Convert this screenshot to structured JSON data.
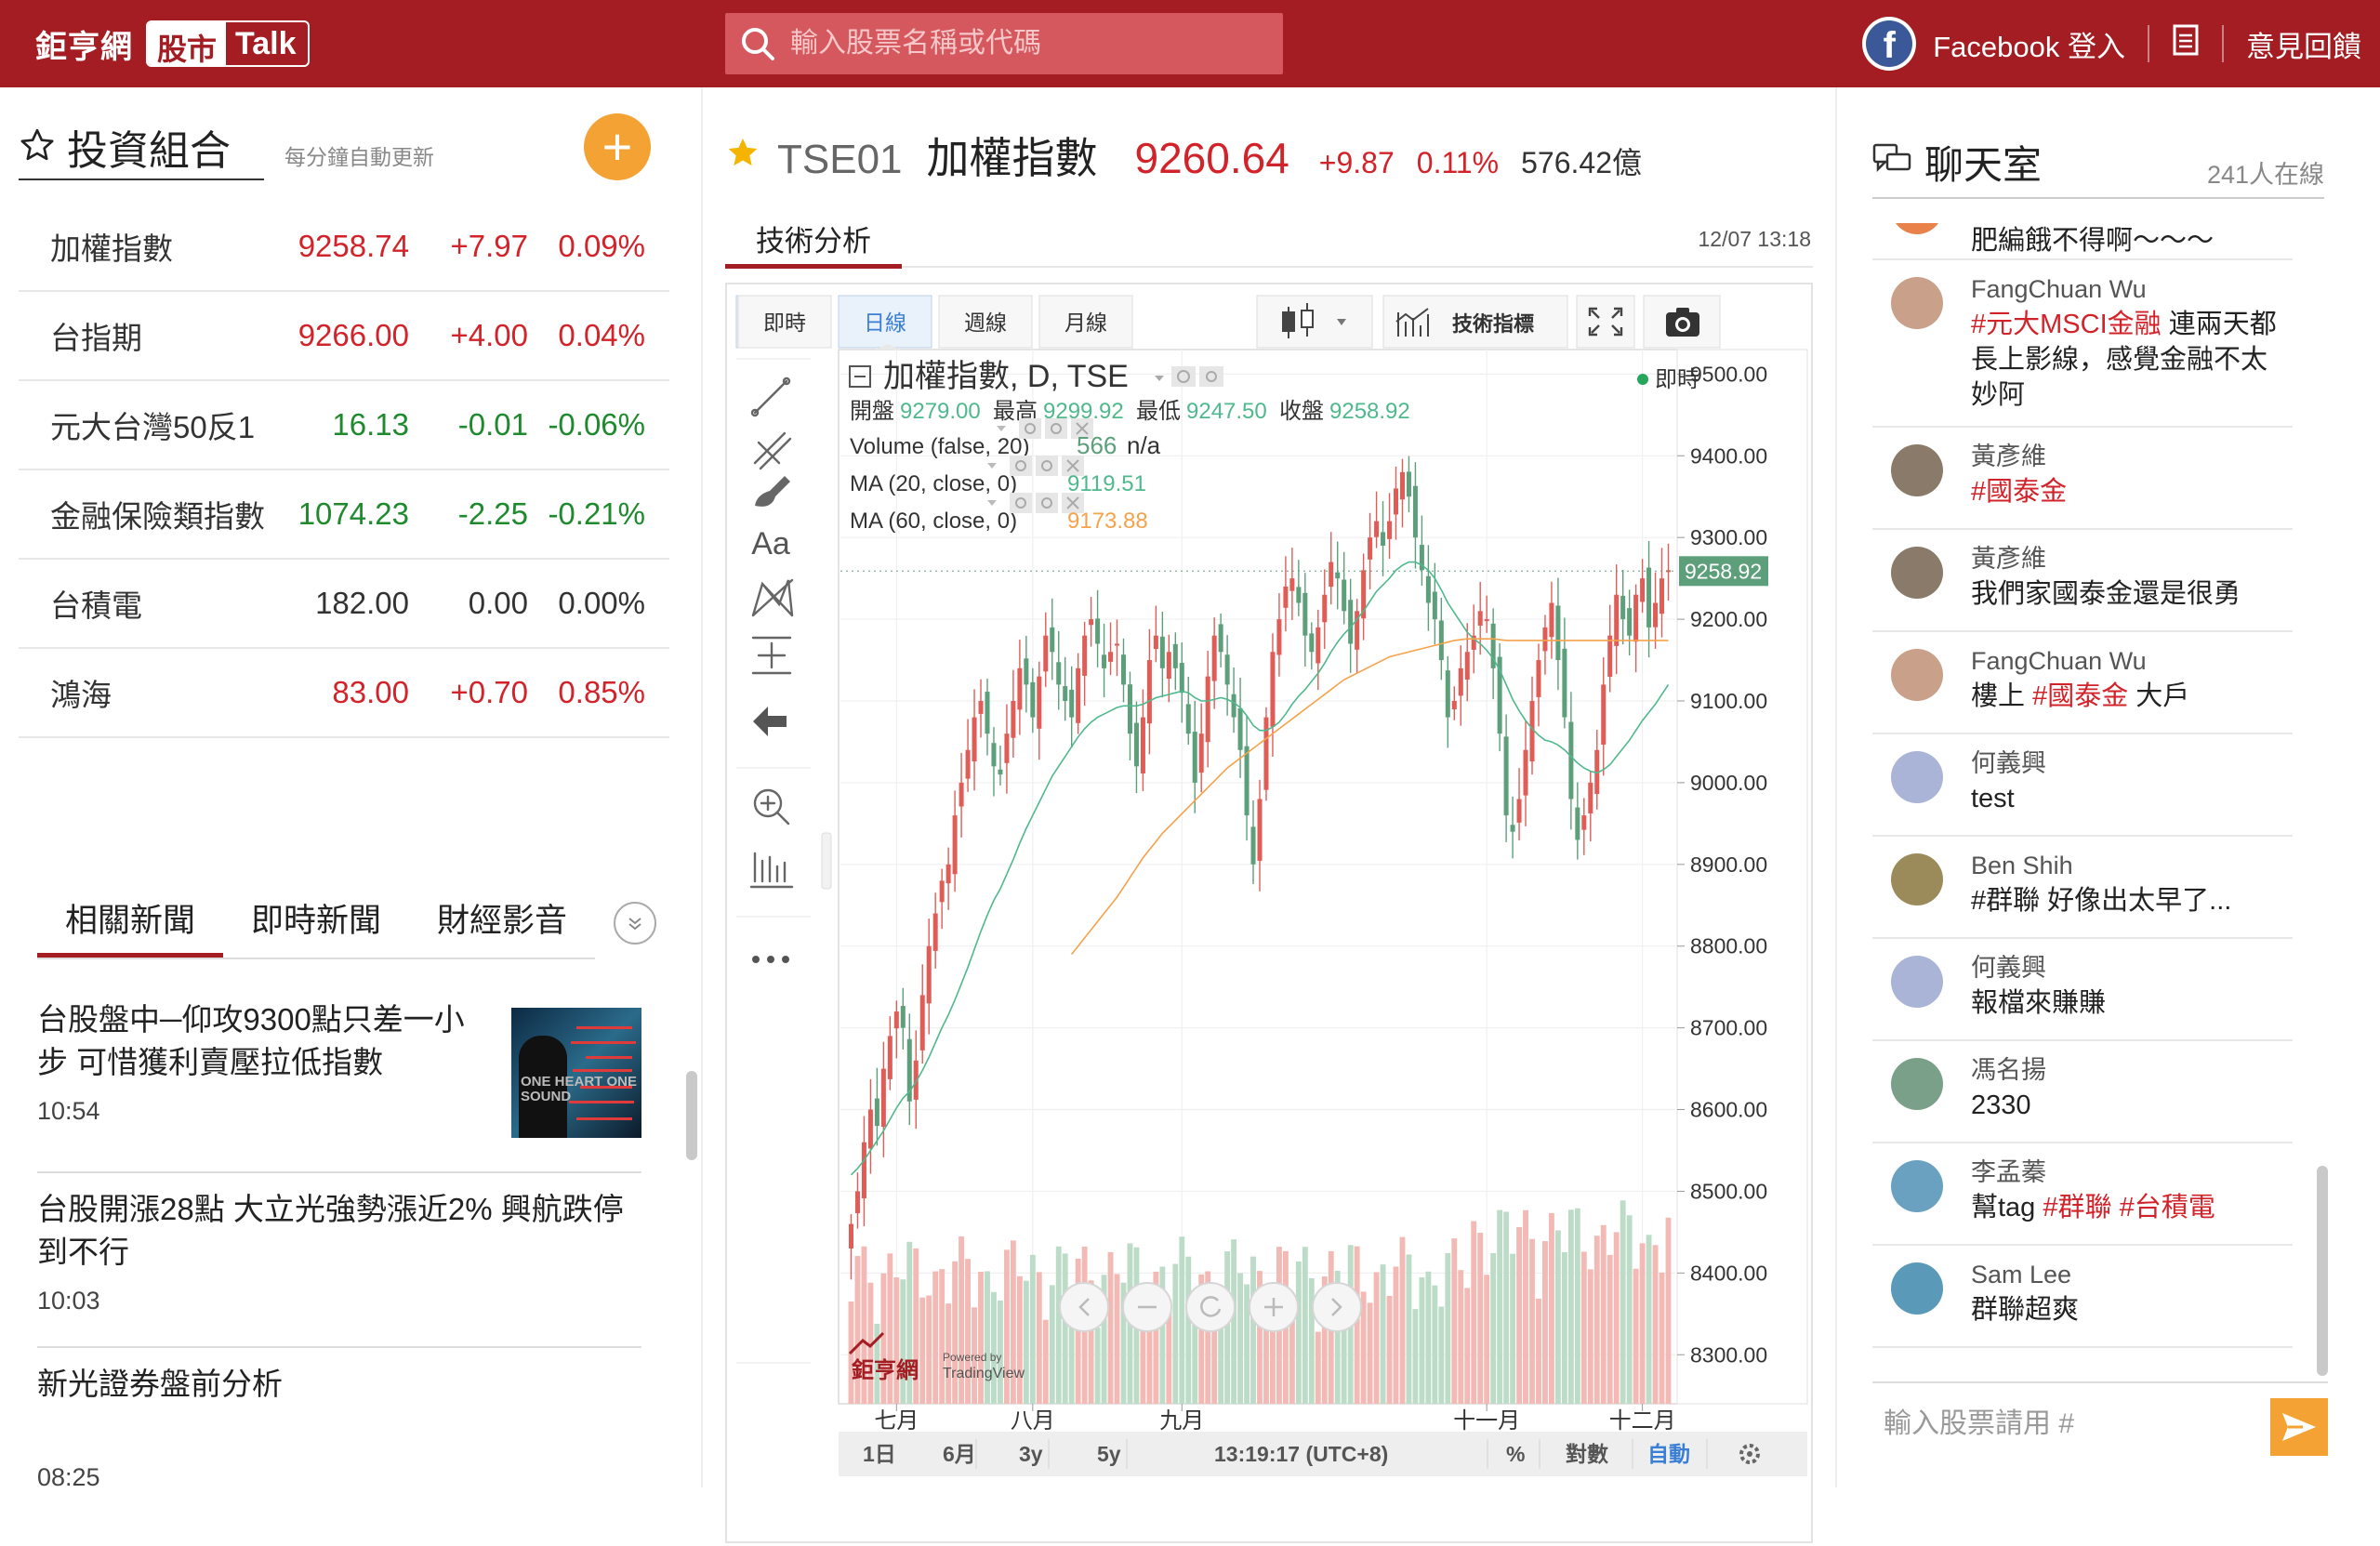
{
  "header": {
    "logo_cn": "鉅亨網",
    "logo_badge": "股市",
    "logo_talk": "Talk",
    "search_placeholder": "輸入股票名稱或代碼",
    "login_label": "Facebook 登入",
    "feedback_label": "意見回饋"
  },
  "portfolio": {
    "title": "投資組合",
    "subtitle": "每分鐘自動更新",
    "add_label": "+",
    "rows": [
      {
        "name": "加權指數",
        "price": "9258.74",
        "change": "+7.97",
        "pct": "0.09%",
        "dir": "up"
      },
      {
        "name": "台指期",
        "price": "9266.00",
        "change": "+4.00",
        "pct": "0.04%",
        "dir": "up"
      },
      {
        "name": "元大台灣50反1",
        "price": "16.13",
        "change": "-0.01",
        "pct": "-0.06%",
        "dir": "dn"
      },
      {
        "name": "金融保險類指數",
        "price": "1074.23",
        "change": "-2.25",
        "pct": "-0.21%",
        "dir": "dn"
      },
      {
        "name": "台積電",
        "price": "182.00",
        "change": "0.00",
        "pct": "0.00%",
        "dir": "flat"
      },
      {
        "name": "鴻海",
        "price": "83.00",
        "change": "+0.70",
        "pct": "0.85%",
        "dir": "up"
      }
    ]
  },
  "news": {
    "tabs": [
      "相關新聞",
      "即時新聞",
      "財經影音"
    ],
    "thumb_text": "ONE HEART ONE SOUND",
    "items": [
      {
        "title": "台股盤中─仰攻9300點只差一小步 可惜獲利賣壓拉低指數",
        "time": "10:54"
      },
      {
        "title": "台股開漲28點 大立光強勢漲近2% 興航跌停到不行",
        "time": "10:03"
      },
      {
        "title": "新光證券盤前分析",
        "time": "08:25"
      }
    ]
  },
  "quote": {
    "code": "TSE01",
    "name": "加權指數",
    "price": "9260.64",
    "change": "+9.87",
    "pct": "0.11%",
    "volume": "576.42億",
    "tab": "技術分析",
    "timestamp": "12/07 13:18"
  },
  "toolbar": {
    "buttons": [
      "即時",
      "日線",
      "週線",
      "月線"
    ],
    "active": "日線",
    "indicators_label": "技術指標",
    "draw_text_tool": "Aa"
  },
  "chart_legend": {
    "title": "加權指數, D, TSE",
    "live_label": "即時",
    "ohlc": [
      {
        "label": "開盤",
        "value": "9279.00"
      },
      {
        "label": "最高",
        "value": "9299.92"
      },
      {
        "label": "最低",
        "value": "9247.50"
      },
      {
        "label": "收盤",
        "value": "9258.92"
      }
    ],
    "volume_label": "Volume (false, 20)",
    "volume_value": "566",
    "volume_na": "n/a",
    "ma20_label": "MA (20, close, 0)",
    "ma20_value": "9119.51",
    "ma60_label": "MA (60, close, 0)",
    "ma60_value": "9173.88",
    "brand": "鉅亨網",
    "powered": "Powered by",
    "tradingview": "TradingView"
  },
  "chart_footer": {
    "ranges": [
      "1日",
      "6月",
      "3y",
      "5y"
    ],
    "time": "13:19:17 (UTC+8)",
    "percent": "%",
    "log": "對數",
    "auto": "自動"
  },
  "chart_data": {
    "type": "candlestick",
    "x_labels": [
      "七月",
      "八月",
      "九月",
      "十一月",
      "十二月"
    ],
    "x_label_positions": [
      7,
      28,
      51,
      98,
      122
    ],
    "y_ticks": [
      "9500.00",
      "9400.00",
      "9300.00",
      "9200.00",
      "9100.00",
      "9000.00",
      "8900.00",
      "8800.00",
      "8700.00",
      "8600.00",
      "8500.00",
      "8400.00",
      "8300.00"
    ],
    "ylim": [
      8240,
      9530
    ],
    "last_price_label": "9258.92",
    "last_price": 9258.92,
    "colors": {
      "up": "#e05d57",
      "down": "#5e9f7b",
      "ma20": "#4fb88d",
      "ma60": "#f5a24b",
      "vol_up": "#f3b9b5",
      "vol_down": "#bcdcc8"
    },
    "closes": [
      8460,
      8500,
      8560,
      8600,
      8580,
      8650,
      8690,
      8720,
      8700,
      8610,
      8660,
      8740,
      8800,
      8840,
      8880,
      8900,
      8960,
      9000,
      9040,
      9080,
      9100,
      9060,
      9020,
      9010,
      9060,
      9100,
      9140,
      9120,
      9080,
      9130,
      9180,
      9160,
      9120,
      9100,
      9080,
      9140,
      9180,
      9200,
      9170,
      9140,
      9160,
      9170,
      9120,
      9060,
      9020,
      9080,
      9150,
      9180,
      9140,
      9160,
      9140,
      9110,
      9060,
      9000,
      9060,
      9130,
      9180,
      9160,
      9120,
      9080,
      9040,
      8960,
      8900,
      8980,
      9080,
      9160,
      9200,
      9240,
      9250,
      9220,
      9180,
      9160,
      9190,
      9230,
      9270,
      9250,
      9210,
      9170,
      9210,
      9260,
      9300,
      9320,
      9290,
      9320,
      9360,
      9380,
      9350,
      9300,
      9260,
      9220,
      9200,
      9150,
      9080,
      9100,
      9140,
      9160,
      9180,
      9210,
      9200,
      9140,
      9060,
      8960,
      8940,
      8980,
      9040,
      9100,
      9150,
      9190,
      9220,
      9150,
      9080,
      8980,
      8930,
      8960,
      9000,
      9040,
      9120,
      9180,
      9230,
      9200,
      9180,
      9230,
      9250,
      9190,
      9220,
      9250,
      9260
    ],
    "ma20": [
      8520,
      8528,
      8538,
      8550,
      8562,
      8574,
      8588,
      8602,
      8614,
      8622,
      8634,
      8648,
      8664,
      8682,
      8700,
      8716,
      8734,
      8754,
      8774,
      8796,
      8818,
      8838,
      8856,
      8870,
      8888,
      8906,
      8926,
      8944,
      8960,
      8976,
      8992,
      9008,
      9020,
      9032,
      9044,
      9056,
      9066,
      9074,
      9080,
      9084,
      9088,
      9092,
      9094,
      9094,
      9094,
      9096,
      9100,
      9104,
      9106,
      9108,
      9110,
      9112,
      9110,
      9104,
      9100,
      9100,
      9102,
      9104,
      9102,
      9098,
      9092,
      9082,
      9070,
      9064,
      9064,
      9068,
      9074,
      9084,
      9096,
      9106,
      9114,
      9124,
      9134,
      9146,
      9160,
      9172,
      9182,
      9190,
      9200,
      9210,
      9222,
      9234,
      9242,
      9250,
      9260,
      9266,
      9270,
      9270,
      9266,
      9260,
      9250,
      9236,
      9220,
      9208,
      9196,
      9184,
      9176,
      9170,
      9162,
      9152,
      9138,
      9120,
      9102,
      9088,
      9076,
      9066,
      9058,
      9052,
      9050,
      9046,
      9040,
      9032,
      9024,
      9018,
      9014,
      9012,
      9016,
      9022,
      9032,
      9042,
      9052,
      9064,
      9076,
      9086,
      9096,
      9108,
      9120
    ],
    "ma60_start": 34,
    "ma60": [
      8790,
      8800,
      8810,
      8820,
      8830,
      8840,
      8850,
      8860,
      8872,
      8884,
      8896,
      8908,
      8918,
      8928,
      8938,
      8946,
      8954,
      8962,
      8970,
      8978,
      8986,
      8994,
      9002,
      9010,
      9018,
      9024,
      9030,
      9036,
      9042,
      9048,
      9054,
      9060,
      9066,
      9072,
      9078,
      9084,
      9090,
      9096,
      9102,
      9108,
      9114,
      9120,
      9126,
      9130,
      9134,
      9138,
      9142,
      9146,
      9150,
      9154,
      9156,
      9158,
      9160,
      9162,
      9164,
      9166,
      9168,
      9170,
      9172,
      9174,
      9175,
      9176,
      9176,
      9176,
      9176,
      9176,
      9175,
      9174,
      9174,
      9174,
      9174,
      9174,
      9174,
      9174,
      9174,
      9174,
      9174,
      9174,
      9174,
      9174,
      9174,
      9174,
      9174,
      9174,
      9174,
      9174,
      9174,
      9174,
      9174,
      9174,
      9174,
      9174,
      9174
    ]
  },
  "chat": {
    "title": "聊天室",
    "online": "241人在線",
    "input_placeholder": "輸入股票請用 #",
    "messages": [
      {
        "user": "",
        "parts": [
          {
            "t": "肥編餓不得啊～～～"
          }
        ],
        "avatar": "#e8824a"
      },
      {
        "user": "FangChuan Wu",
        "parts": [
          {
            "t": "#元大MSCI金融",
            "tag": true
          },
          {
            "t": " 連兩天都長上影線，感覺金融不太妙阿"
          }
        ],
        "avatar": "#c9a08a"
      },
      {
        "user": "黃彥維",
        "parts": [
          {
            "t": "#國泰金",
            "tag": true
          }
        ],
        "avatar": "#8a7a6a"
      },
      {
        "user": "黃彥維",
        "parts": [
          {
            "t": "我們家國泰金還是很勇"
          }
        ],
        "avatar": "#8a7a6a"
      },
      {
        "user": "FangChuan Wu",
        "parts": [
          {
            "t": "樓上 "
          },
          {
            "t": "#國泰金",
            "tag": true
          },
          {
            "t": " 大戶"
          }
        ],
        "avatar": "#c9a08a"
      },
      {
        "user": "何義興",
        "parts": [
          {
            "t": "test"
          }
        ],
        "avatar": "#aab4d6"
      },
      {
        "user": "Ben Shih",
        "parts": [
          {
            "t": "#群聯 好像出太早了..."
          }
        ],
        "avatar": "#9b8b5a"
      },
      {
        "user": "何義興",
        "parts": [
          {
            "t": "報檔來賺賺"
          }
        ],
        "avatar": "#aab4d6"
      },
      {
        "user": "馮名揚",
        "parts": [
          {
            "t": "2330"
          }
        ],
        "avatar": "#7aa08a"
      },
      {
        "user": "李孟蓁",
        "parts": [
          {
            "t": "幫tag "
          },
          {
            "t": "#群聯",
            "tag": true
          },
          {
            "t": " "
          },
          {
            "t": "#台積電",
            "tag": true
          }
        ],
        "avatar": "#6aa0c0"
      },
      {
        "user": "Sam Lee",
        "parts": [
          {
            "t": "群聯超爽"
          }
        ],
        "avatar": "#5a9ab8"
      }
    ]
  }
}
